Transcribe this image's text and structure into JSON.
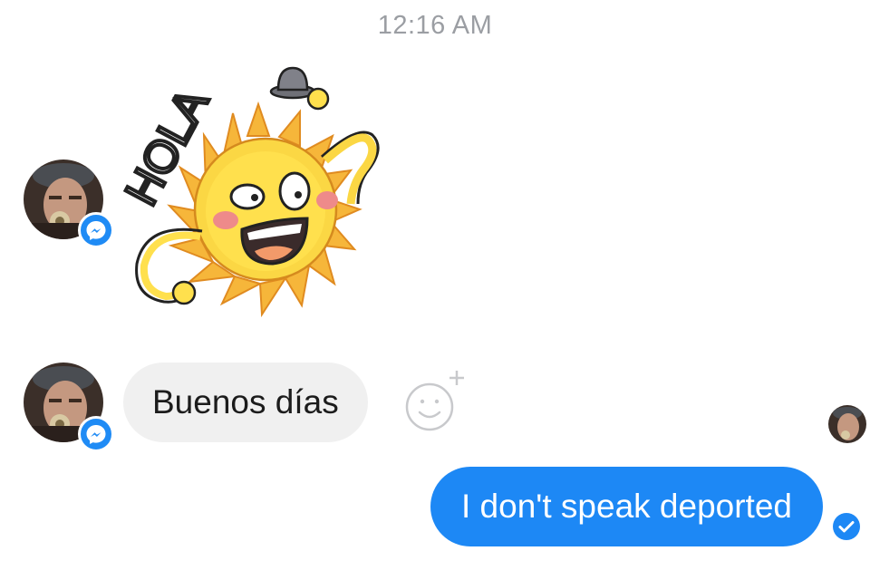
{
  "chat": {
    "timestamp": "12:16 AM",
    "messages": [
      {
        "sender": "contact",
        "type": "sticker",
        "sticker_text": "HOLA",
        "sticker_name": "waving-sun-sticker"
      },
      {
        "sender": "contact",
        "type": "text",
        "text": "Buenos días"
      },
      {
        "sender": "me",
        "type": "text",
        "text": "I don't speak deported",
        "status": "delivered"
      }
    ],
    "icons": {
      "badge": "messenger-badge-icon",
      "react": "add-reaction-icon",
      "status": "delivered-check-icon"
    },
    "colors": {
      "outgoing_bubble": "#1d88f5",
      "incoming_bubble": "#f0f0f0",
      "timestamp": "#9b9ea3",
      "badge": "#1f8bf5"
    }
  }
}
